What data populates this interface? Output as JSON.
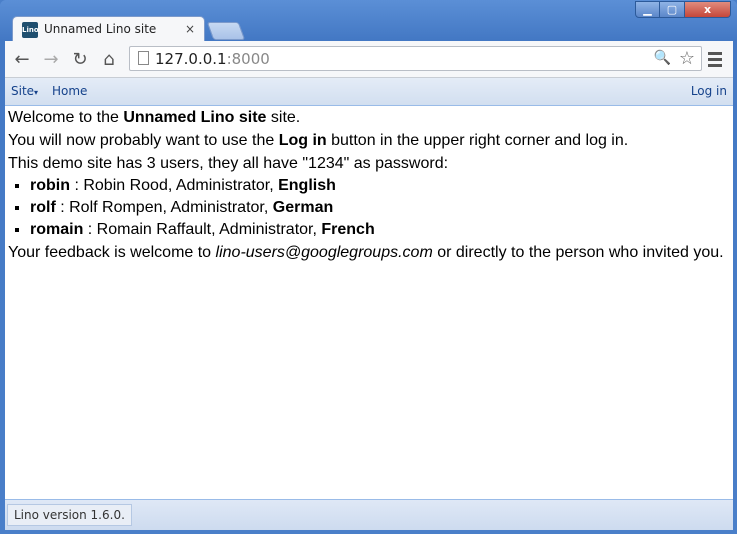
{
  "window": {
    "controls": {
      "minimize": "▁",
      "maximize": "▢",
      "close": "x"
    }
  },
  "tab": {
    "title": "Unnamed Lino site",
    "close": "×",
    "favicon_text": "Lino"
  },
  "toolbar": {
    "url_host": "127.0.0.1",
    "url_port": ":8000",
    "back_icon": "←",
    "forward_icon": "→",
    "reload_icon": "↻",
    "home_icon": "⌂",
    "zoom_icon": "🔍",
    "star_icon": "☆"
  },
  "lino_bar": {
    "site_label": "Site",
    "site_arrow": "▾",
    "home_label": "Home",
    "login_label": "Log in"
  },
  "content": {
    "welcome_pre": "Welcome to the ",
    "site_name": "Unnamed Lino site",
    "welcome_post": " site.",
    "line2_pre": "You will now probably want to use the ",
    "line2_bold": "Log in",
    "line2_post": " button in the upper right corner and log in.",
    "line3": "This demo site has 3 users, they all have \"1234\" as password:",
    "users": [
      {
        "username": "robin",
        "desc": " : Robin Rood, Administrator, ",
        "language": "English"
      },
      {
        "username": "rolf",
        "desc": " : Rolf Rompen, Administrator, ",
        "language": "German"
      },
      {
        "username": "romain",
        "desc": " : Romain Raffault, Administrator, ",
        "language": "French"
      }
    ],
    "feedback_pre": "Your feedback is welcome to ",
    "feedback_email": "lino-users@googlegroups.com",
    "feedback_post": " or directly to the person who invited you."
  },
  "footer": {
    "version": "Lino version 1.6.0."
  }
}
